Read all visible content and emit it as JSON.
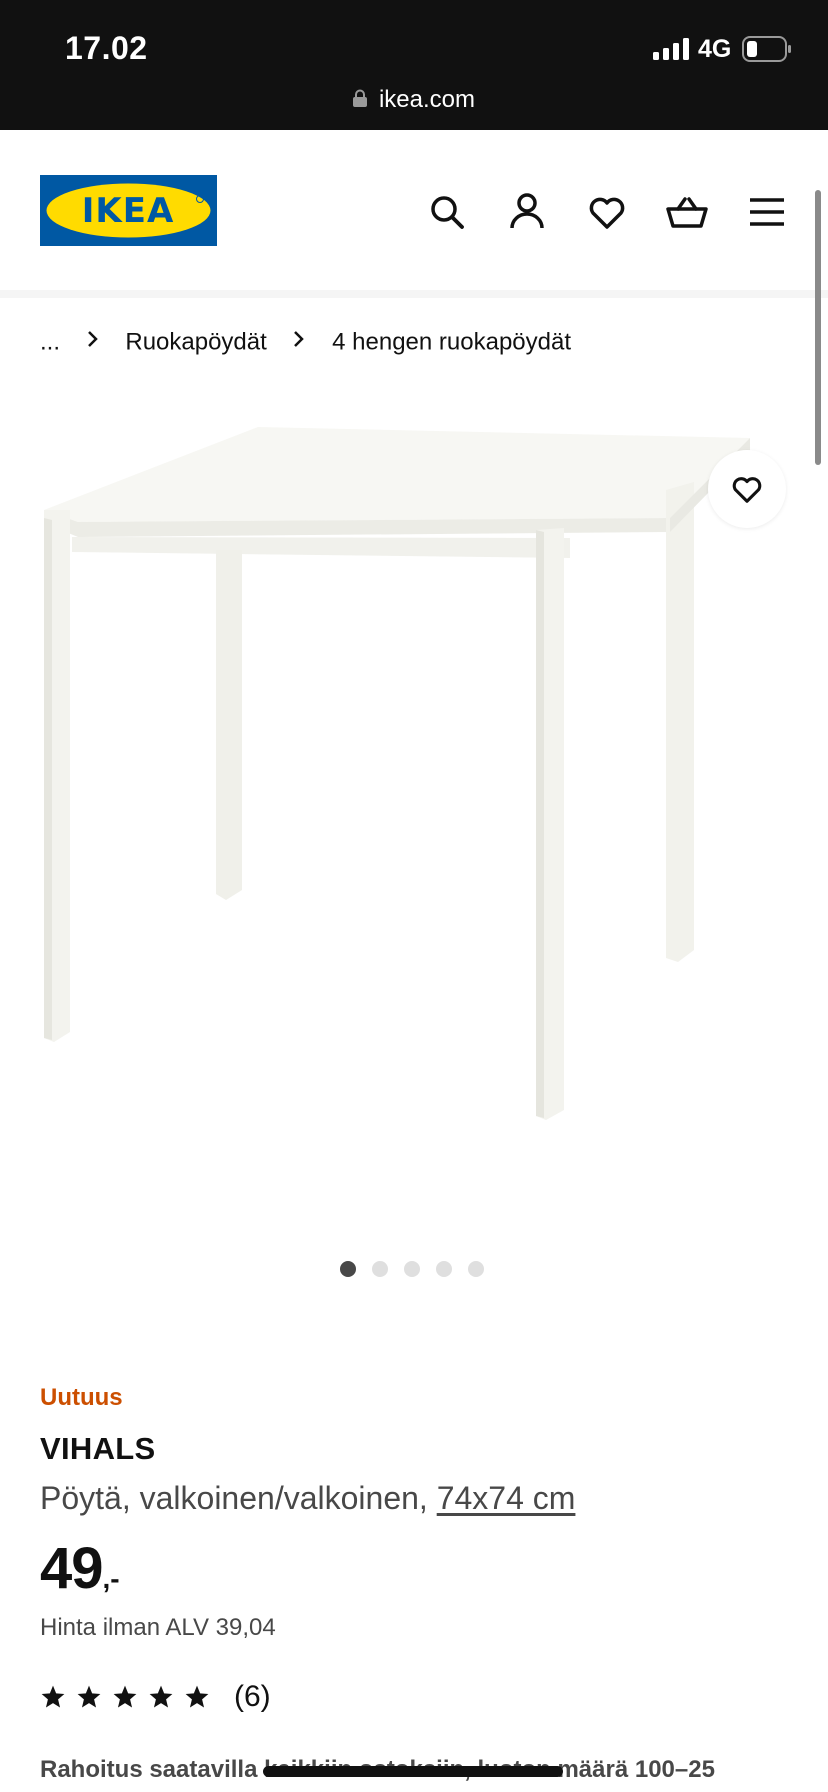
{
  "status_bar": {
    "time": "17.02",
    "network": "4G",
    "url": "ikea.com"
  },
  "header": {
    "logo_text": "IKEA",
    "icons": [
      "search-icon",
      "account-icon",
      "heart-icon",
      "basket-icon",
      "menu-icon"
    ]
  },
  "breadcrumb": {
    "items": [
      "...",
      "Ruokapöydät",
      "4 hengen ruokapöydät"
    ]
  },
  "gallery": {
    "image_count": 5,
    "active_index": 0
  },
  "product": {
    "badge": "Uutuus",
    "name": "VIHALS",
    "description": "Pöytä, valkoinen/valkoinen,",
    "size": "74x74 cm",
    "price_integer": "49",
    "price_decimal": ",-",
    "price_without_vat": "Hinta ilman ALV 39,04",
    "rating_stars": 5,
    "review_count": "(6)",
    "financing": "Rahoitus saatavilla kaikkiin ostoksiin, luoton määrä 100–25"
  },
  "colors": {
    "ikea_blue": "#0058a3",
    "ikea_yellow": "#ffdb00",
    "new_badge": "#cc4f00",
    "status_bar_bg": "#111111"
  }
}
